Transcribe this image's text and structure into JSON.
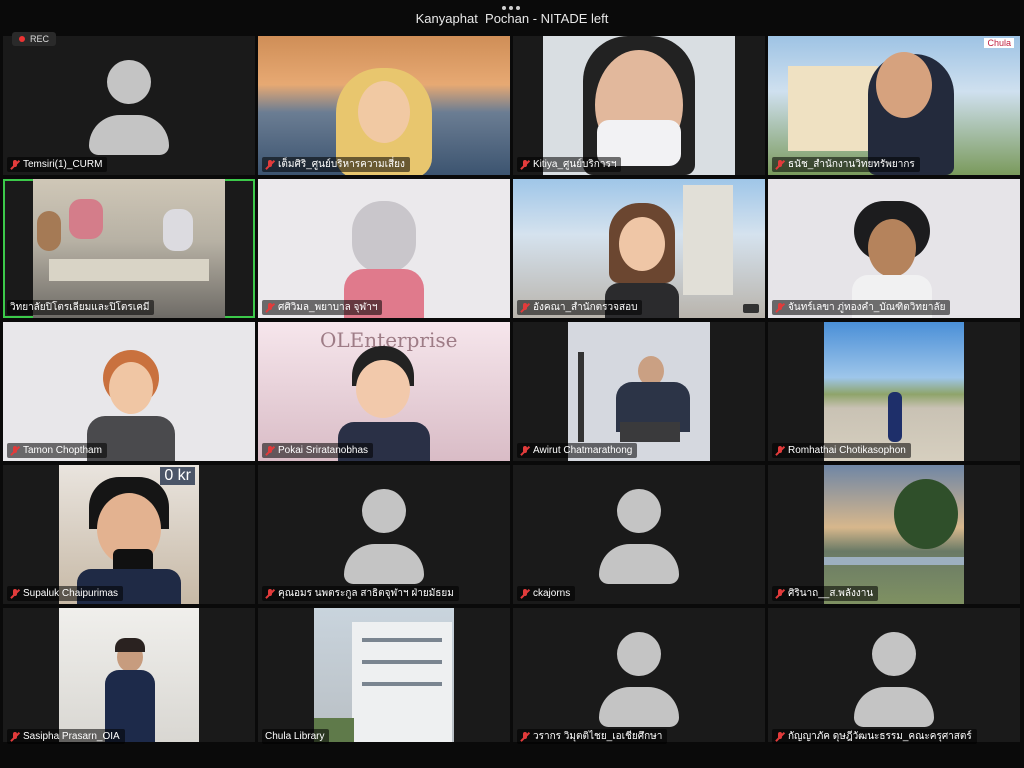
{
  "window": {
    "title": "Kanyaphat  Pochan - NITADE left",
    "recording_label": "REC"
  },
  "participants": [
    {
      "name": "Temsiri(1)_CURM",
      "video": false
    },
    {
      "name": "เต็มศิริ_ศูนย์บริหารความเสี่ยง",
      "video": true
    },
    {
      "name": "Kitiya_ศูนย์บริการฯ",
      "video": true
    },
    {
      "name": "ธนัช_สำนักงานวิทยทรัพยากร",
      "video": true
    },
    {
      "name": "วิทยาลัยปิโตรเลียมและปิโตรเคมี",
      "video": true,
      "active_speaker": true
    },
    {
      "name": "ศศิวิมล_พยาบาล จุฬาฯ",
      "video": true
    },
    {
      "name": "อังคณา_สำนักตรวจสอบ",
      "video": true
    },
    {
      "name": "จันทร์เลขา ภู่ทองคำ_บัณฑิตวิทยาลัย",
      "video": true
    },
    {
      "name": "Tamon Choptham",
      "video": true
    },
    {
      "name": "Pokai Sriratanobhas",
      "video": true
    },
    {
      "name": "Awirut Chatmarathong",
      "video": true
    },
    {
      "name": "Romhathai Chotikasophon",
      "video": true
    },
    {
      "name": "Supaluk Chaipurimas",
      "video": true
    },
    {
      "name": "คุณอมร นพตระกูล สาธิตจุฬาฯ ฝ่ายมัธยม",
      "video": false
    },
    {
      "name": "ckajorns",
      "video": false
    },
    {
      "name": "ศิรินาถ__ส.พลังงาน",
      "video": true
    },
    {
      "name": "Sasipha Prasarn_OIA",
      "video": true
    },
    {
      "name": "Chula Library",
      "video": true,
      "muted": false
    },
    {
      "name": "วรากร วิมุตติไชย_เอเชียศึกษา",
      "video": false
    },
    {
      "name": "กัญญาภัค ดุษฎีวัฒนะธรรม_คณะครุศาสตร์",
      "video": false
    }
  ],
  "overlays": {
    "poster_text": "OLEnterprise",
    "sign_text": "0 kr",
    "logo_text": "Chula"
  }
}
